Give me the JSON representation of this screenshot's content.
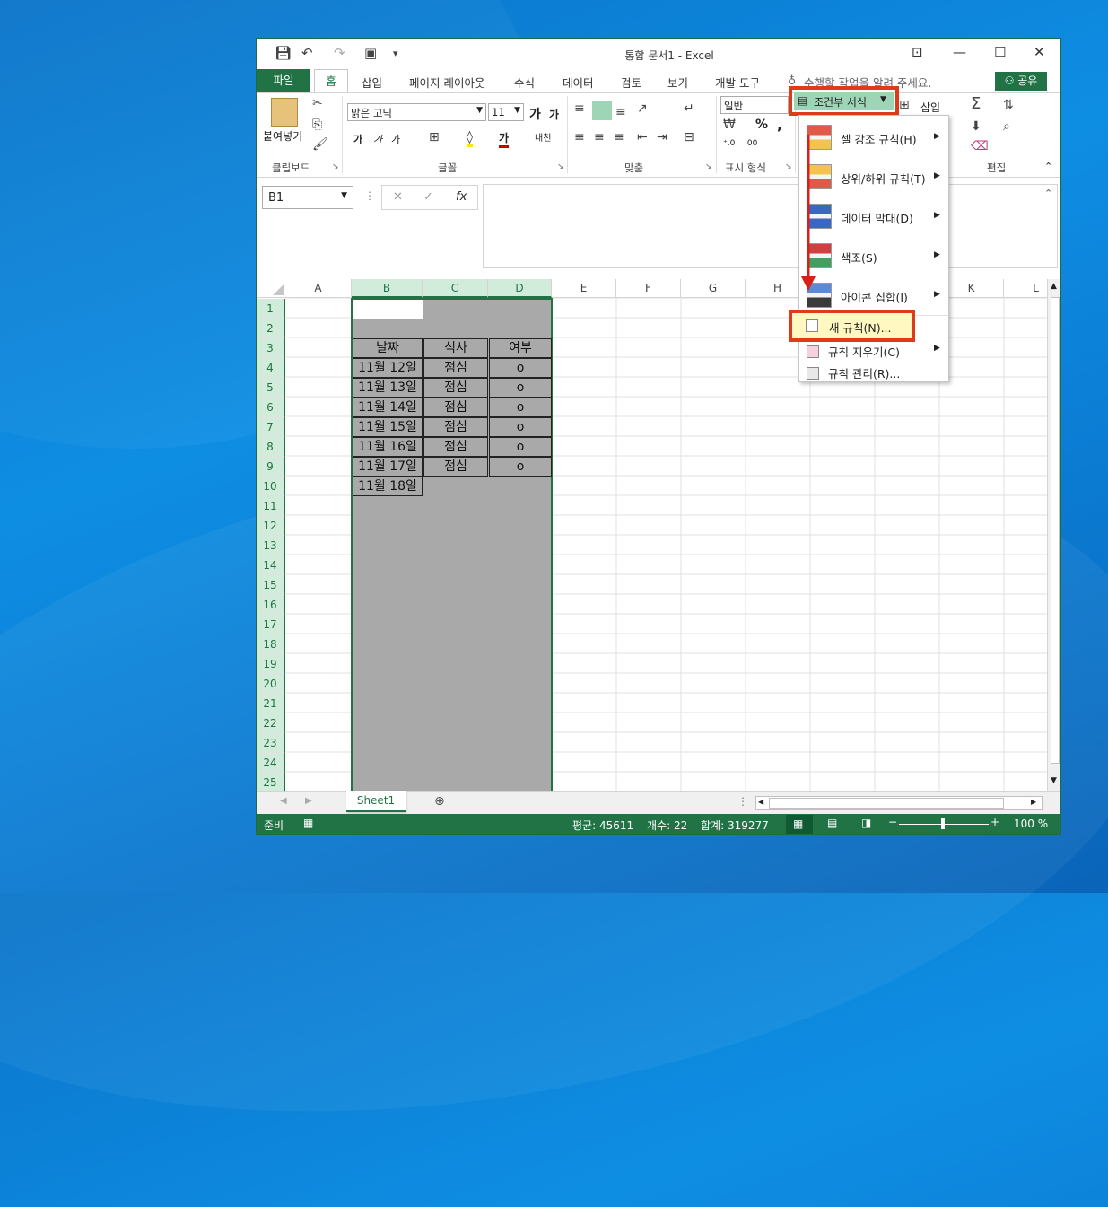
{
  "window": {
    "title": "통합 문서1 - Excel"
  },
  "tabs": [
    "파일",
    "홈",
    "삽입",
    "페이지 레이아웃",
    "수식",
    "데이터",
    "검토",
    "보기",
    "개발 도구"
  ],
  "tell_me": "수행할 작업을 알려 주세요.",
  "share": "공유",
  "ribbon": {
    "paste": "붙여넣기",
    "clipboard": "클립보드",
    "font_name": "맑은 고딕",
    "font_size": "11",
    "font_group": "글꼴",
    "align_group": "맞춤",
    "number_format": "일반",
    "number_group": "표시 형식",
    "cond_format": "조건부 서식",
    "insert": "삽입",
    "edit_group": "편집",
    "grow": "가",
    "shrink": "가",
    "bold": "가",
    "italic": "가",
    "underline": "가",
    "font_color": "가",
    "phonetic": "내천",
    "sigma": "Σ",
    "percent": "%",
    "comma": ","
  },
  "formula": {
    "namebox": "B1",
    "fx": "fx"
  },
  "columns": [
    "A",
    "B",
    "C",
    "D",
    "E",
    "F",
    "G",
    "H",
    "I",
    "J",
    "K",
    "L"
  ],
  "rows": [
    "1",
    "2",
    "3",
    "4",
    "5",
    "6",
    "7",
    "8",
    "9",
    "10",
    "11",
    "12",
    "13",
    "14",
    "15",
    "16",
    "17",
    "18",
    "19",
    "20",
    "21",
    "22",
    "23",
    "24",
    "25"
  ],
  "table": {
    "headers": [
      "날짜",
      "식사",
      "여부"
    ],
    "rows": [
      [
        "11월 12일",
        "점심",
        "o"
      ],
      [
        "11월 13일",
        "점심",
        "o"
      ],
      [
        "11월 14일",
        "점심",
        "o"
      ],
      [
        "11월 15일",
        "점심",
        "o"
      ],
      [
        "11월 16일",
        "점심",
        "o"
      ],
      [
        "11월 17일",
        "점심",
        "o"
      ],
      [
        "11월 18일",
        "",
        ""
      ]
    ]
  },
  "sheet_tab": "Sheet1",
  "status": {
    "ready": "준비",
    "avg": "평균: 45611",
    "count": "개수: 22",
    "sum": "합계: 319277",
    "zoom": "100 %"
  },
  "menu": [
    {
      "label": "셀 강조 규칙(H)",
      "icon": "highlight-cells-icon",
      "arrow": true
    },
    {
      "label": "상위/하위 규칙(T)",
      "icon": "top-bottom-icon",
      "arrow": true
    },
    {
      "label": "데이터 막대(D)",
      "icon": "data-bars-icon",
      "arrow": true
    },
    {
      "label": "색조(S)",
      "icon": "color-scales-icon",
      "arrow": true
    },
    {
      "label": "아이콘 집합(I)",
      "icon": "icon-sets-icon",
      "arrow": true
    }
  ],
  "menu_small": [
    {
      "label": "새 규칙(N)...",
      "arrow": false
    },
    {
      "label": "규칙 지우기(C)",
      "arrow": true
    },
    {
      "label": "규칙 관리(R)...",
      "arrow": false
    }
  ],
  "icon_text": {
    "highlight": "≤>",
    "topbottom": "10"
  },
  "colors": {
    "excel_green": "#217346",
    "highlight": "#e03a1a",
    "selection": "#a9a9a9"
  }
}
